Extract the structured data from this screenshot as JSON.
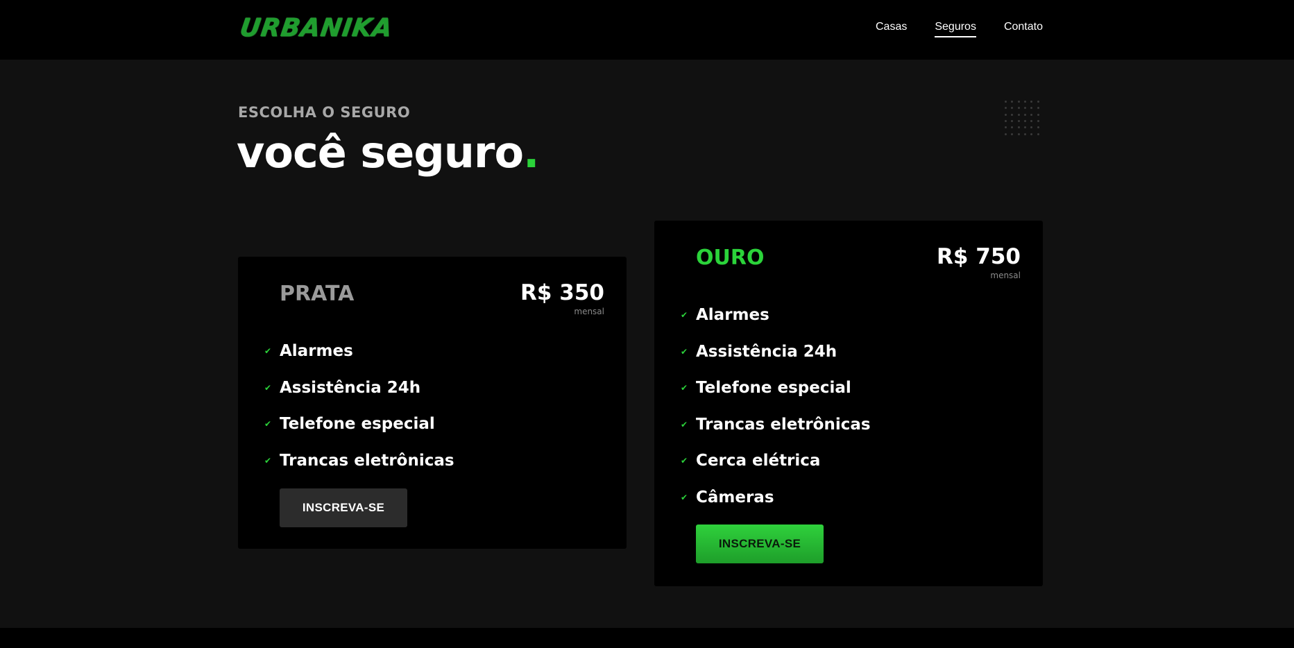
{
  "brand": {
    "logo_text": "URBANIKA",
    "accent": "#2bd33a"
  },
  "nav": {
    "items": [
      "Casas",
      "Seguros",
      "Contato"
    ],
    "active": "Seguros"
  },
  "hero": {
    "eyebrow": "ESCOLHA O SEGURO",
    "title": "você seguro",
    "title_dot": "."
  },
  "plans": [
    {
      "name": "PRATA",
      "price": "R$ 350",
      "period": "mensal",
      "features": [
        "Alarmes",
        "Assistência 24h",
        "Telefone especial",
        "Trancas eletrônicas"
      ],
      "cta": "INSCREVA-SE"
    },
    {
      "name": "OURO",
      "price": "R$ 750",
      "period": "mensal",
      "features": [
        "Alarmes",
        "Assistência 24h",
        "Telefone especial",
        "Trancas eletrônicas",
        "Cerca elétrica",
        "Câmeras"
      ],
      "cta": "INSCREVA-SE"
    }
  ],
  "icons": {
    "feature_check": "check-icon",
    "decoration": "dot-grid-icon"
  }
}
